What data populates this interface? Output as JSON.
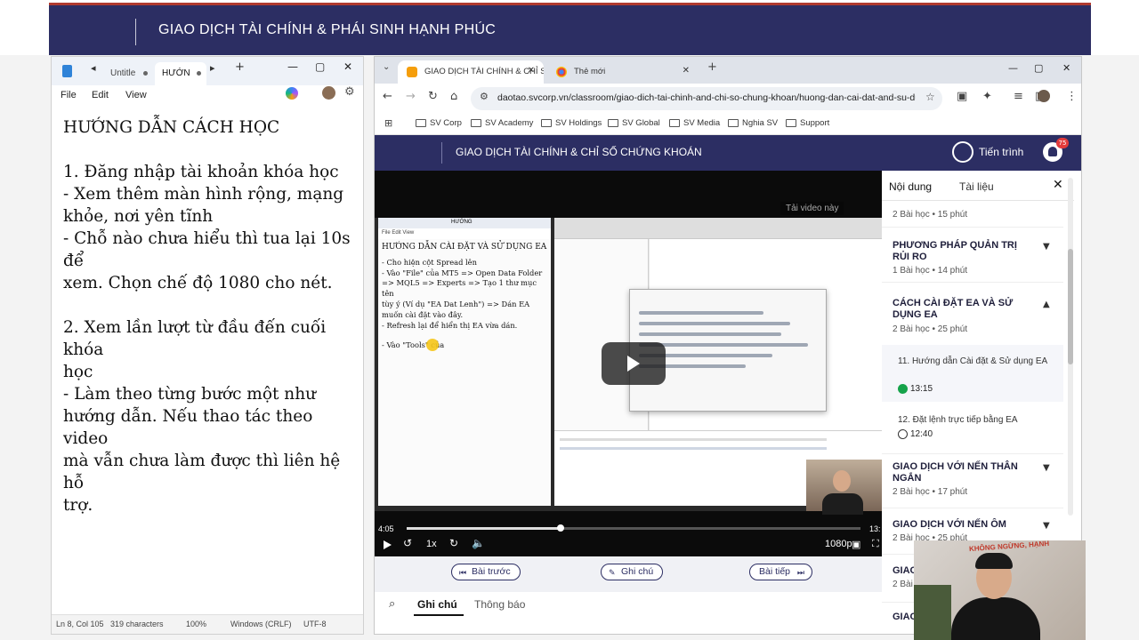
{
  "banner": {
    "title": "GIAO DỊCH TÀI CHÍNH & PHÁI SINH HẠNH PHÚC"
  },
  "notepad": {
    "tabs": [
      {
        "label": "Untitle"
      },
      {
        "label": "HƯỚN"
      }
    ],
    "menu": [
      "File",
      "Edit",
      "View"
    ],
    "lines": [
      "HƯỚNG DẪN CÁCH HỌC",
      "",
      "1. Đăng nhập tài khoản khóa học",
      "- Xem thêm màn hình rộng, mạng",
      "khỏe, nơi yên tĩnh",
      "- Chỗ nào chưa hiểu thì tua lại 10s để",
      "xem. Chọn chế độ 1080 cho nét.",
      "",
      "2. Xem lần lượt từ đầu đến cuối khóa",
      "học",
      "- Làm theo từng bước một như",
      "hướng dẫn. Nếu thao tác theo video",
      "mà vẫn chưa làm được thì liên hệ hỗ",
      "trợ."
    ],
    "status": {
      "position": "Ln 8, Col 105",
      "characters": "319 characters",
      "zoom": "100%",
      "line_ending": "Windows (CRLF)",
      "encoding": "UTF-8"
    }
  },
  "browser": {
    "tabs": [
      {
        "label": "GIAO DỊCH TÀI CHÍNH & CHỈ SỐ",
        "active": true
      },
      {
        "label": "Thẻ mới",
        "active": false
      }
    ],
    "url": "daotao.svcorp.vn/classroom/giao-dich-tai-chinh-and-chi-so-chung-khoan/huong-dan-cai-dat-and-su-du...",
    "bookmarks": [
      "SV Corp",
      "SV Academy",
      "SV Holdings",
      "SV Global",
      "SV Media",
      "Nghia SV",
      "Support"
    ]
  },
  "site": {
    "title": "GIAO DỊCH TÀI CHÍNH & CHỈ SỐ CHỨNG KHOÁN",
    "progress_label": "Tiến trình",
    "notification_count": "75",
    "video": {
      "tooltip": "Tải video này",
      "inner_notepad": {
        "tab": "HƯỚNG",
        "menu": "File   Edit   View",
        "heading": "HƯỚNG DẪN CÀI ĐẶT VÀ SỬ DỤNG EA",
        "lines": [
          "- Cho hiện cột Spread lên",
          "- Vào \"File\" của MT5 => Open Data Folder",
          "=> MQL5 => Experts => Tạo 1 thư mục tên",
          "tùy ý (Ví dụ \"EA Dat Lenh\") => Dán EA",
          "muốn cài đặt vào đây.",
          "- Refresh lại để hiển thị EA vừa dán.",
          "",
          "- Vào \"Tools\" của"
        ]
      },
      "current_time": "4:05",
      "total_time": "13:",
      "progress": 0.34,
      "speed": "1x",
      "quality": "1080p"
    },
    "nav_buttons": {
      "prev": "Bài trước",
      "notes": "Ghi chú",
      "next": "Bài tiếp"
    },
    "bottom_tabs": {
      "notes": "Ghi chú",
      "announcements": "Thông báo"
    },
    "panel": {
      "tabs": {
        "content": "Nội dung",
        "documents": "Tài liệu"
      },
      "partial_top_meta": "2 Bài học • 15 phút",
      "sections": [
        {
          "title": "PHƯƠNG PHÁP QUẢN TRỊ RỦI RO",
          "meta": "1 Bài học • 14 phút"
        },
        {
          "title": "CÁCH CÀI ĐẶT EA VÀ SỬ DỤNG EA",
          "meta": "2 Bài học • 25 phút"
        },
        {
          "title": "GIAO DỊCH VỚI NẾN THÂN NGẮN",
          "meta": "2 Bài học • 17 phút"
        },
        {
          "title": "GIAO DỊCH VỚI NẾN ÔM",
          "meta": "2 Bài học • 25 phút"
        },
        {
          "title": "GIAO",
          "meta": "2 Bài"
        },
        {
          "title": "GIAO",
          "meta": ""
        }
      ],
      "lessons": [
        {
          "title": "11. Hướng dẫn Cài đặt & Sử dụng EA",
          "duration": "13:15"
        },
        {
          "title": "12. Đặt lệnh trực tiếp bằng EA",
          "duration": "12:40"
        }
      ]
    }
  },
  "webcam": {
    "sign_text": "KHÔNG NGỪNG, HẠNH"
  }
}
